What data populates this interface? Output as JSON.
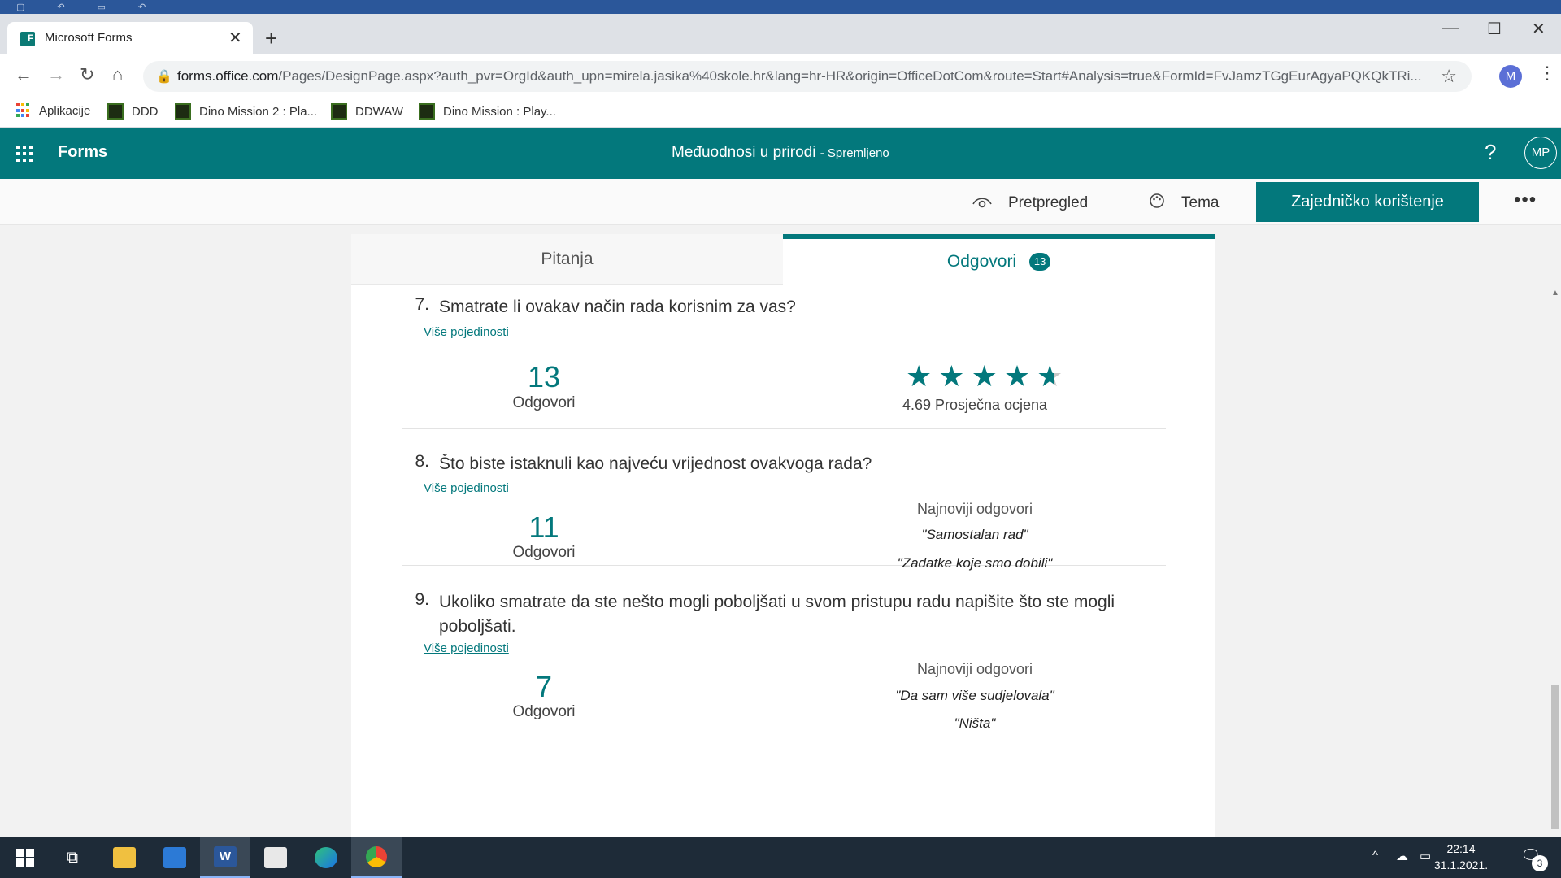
{
  "browser": {
    "tab_title": "Microsoft Forms",
    "close_tab": "✕",
    "new_tab": "+",
    "url_main": "forms.office.com",
    "url_rest": "/Pages/DesignPage.aspx?auth_pvr=OrgId&auth_upn=mirela.jasika%40skole.hr&lang=hr-HR&origin=OfficeDotCom&route=Start#Analysis=true&FormId=FvJamzTGgEurAgyaPQKQkTRi...",
    "profile_initial": "M",
    "bookmarks": [
      {
        "label": "Aplikacije"
      },
      {
        "label": "DDD"
      },
      {
        "label": "Dino Mission 2 : Pla..."
      },
      {
        "label": "DDWAW"
      },
      {
        "label": "Dino Mission : Play..."
      }
    ]
  },
  "forms": {
    "brand": "Forms",
    "form_title": "Međuodnosi u prirodi",
    "saved_status": "- Spremljeno",
    "help": "?",
    "user_initials": "MP",
    "commands": {
      "preview": "Pretpregled",
      "theme": "Tema",
      "share": "Zajedničko korištenje",
      "more": "•••"
    },
    "tabs": {
      "questions": "Pitanja",
      "responses": "Odgovori",
      "responses_count": "13"
    }
  },
  "questions": [
    {
      "number": "7.",
      "text": "Smatrate li ovakav način rada korisnim za vas?",
      "details": "Više pojedinosti",
      "count": "13",
      "count_label": "Odgovori",
      "rating_stars": 4.69,
      "avg_text": "4.69 Prosječna ocjena"
    },
    {
      "number": "8.",
      "text": "Što biste istaknuli kao najveću vrijednost ovakvoga rada?",
      "details": "Više pojedinosti",
      "count": "11",
      "count_label": "Odgovori",
      "recent_head": "Najnoviji odgovori",
      "recent": [
        "\"Samostalan rad\"",
        "\"Zadatke koje smo dobili\""
      ]
    },
    {
      "number": "9.",
      "text": "Ukoliko smatrate da ste nešto mogli poboljšati u svom pristupu radu napišite što ste mogli poboljšati.",
      "details": "Više pojedinosti",
      "count": "7",
      "count_label": "Odgovori",
      "recent_head": "Najnoviji odgovori",
      "recent": [
        "\"Da sam više sudjelovala\"",
        "\"Ništa\""
      ]
    }
  ],
  "taskbar": {
    "time": "22:14",
    "date": "31.1.2021.",
    "notifications": "3"
  },
  "colors": {
    "accent": "#03787c",
    "taskbar": "#1e2b38"
  }
}
